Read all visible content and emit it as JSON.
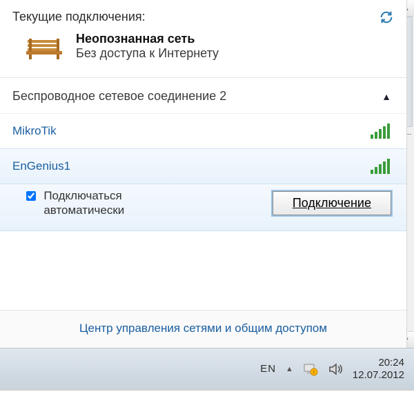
{
  "header": {
    "title": "Текущие подключения:"
  },
  "current": {
    "name": "Неопознанная сеть",
    "status": "Без доступа к Интернету"
  },
  "section": {
    "title": "Беспроводное сетевое соединение 2"
  },
  "networks": [
    {
      "name": "MikroTik",
      "signal": 5,
      "selected": false
    },
    {
      "name": "EnGenius1",
      "signal": 5,
      "selected": true
    }
  ],
  "auto_connect": {
    "label": "Подключаться автоматически",
    "checked": true
  },
  "connect_button": "Подключение",
  "footer_link": "Центр управления сетями и общим доступом",
  "tray": {
    "lang": "EN",
    "time": "20:24",
    "date": "12.07.2012"
  }
}
